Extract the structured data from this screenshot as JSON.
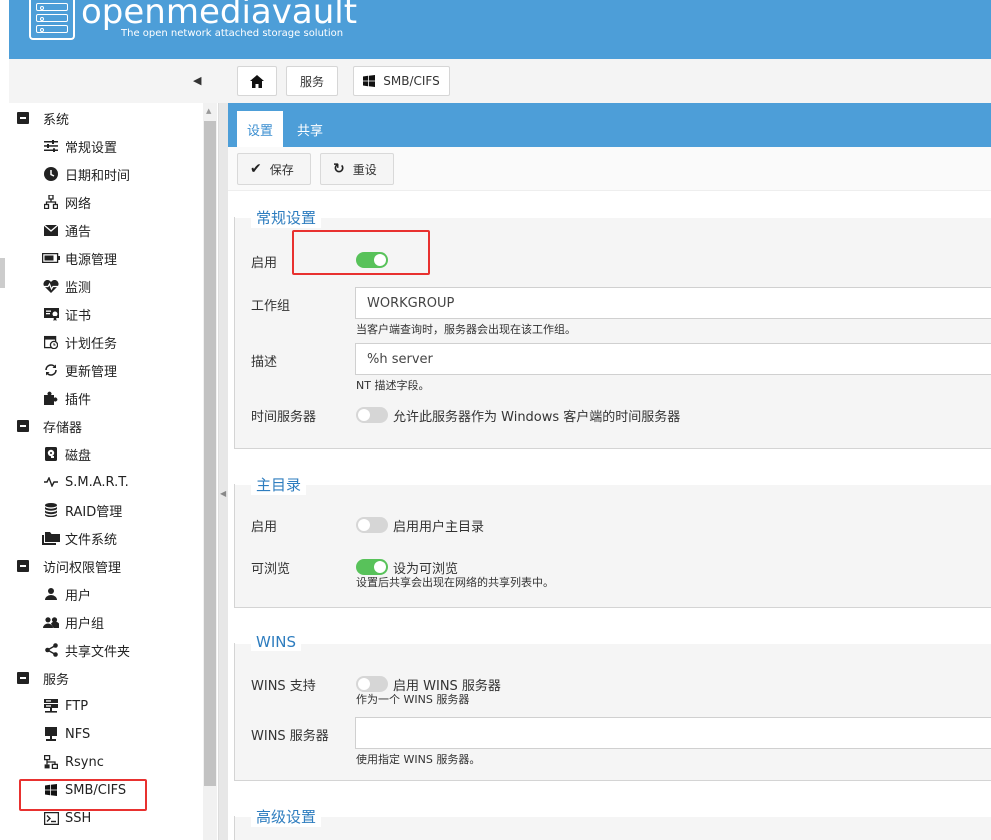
{
  "header": {
    "title": "openmediavault",
    "subtitle": "The open network attached storage solution"
  },
  "breadcrumb": {
    "home_icon": "home-icon",
    "items": [
      "服务",
      "SMB/CIFS"
    ]
  },
  "sidebar": {
    "groups": {
      "system": "系统",
      "storage": "存储器",
      "access": "访问权限管理",
      "services": "服务"
    },
    "items": {
      "general": "常规设置",
      "datetime": "日期和时间",
      "network": "网络",
      "notification": "通告",
      "power": "电源管理",
      "monitoring": "监测",
      "certificates": "证书",
      "scheduled": "计划任务",
      "updates": "更新管理",
      "plugins": "插件",
      "disks": "磁盘",
      "smart": "S.M.A.R.T.",
      "raid": "RAID管理",
      "filesystems": "文件系统",
      "users": "用户",
      "usergroups": "用户组",
      "sharedfolders": "共享文件夹",
      "ftp": "FTP",
      "nfs": "NFS",
      "rsync": "Rsync",
      "smb": "SMB/CIFS",
      "ssh": "SSH"
    }
  },
  "tabs": [
    "设置",
    "共享"
  ],
  "actions": {
    "save": "保存",
    "reset": "重设"
  },
  "general": {
    "legend": "常规设置",
    "enable_label": "启用",
    "enabled": true,
    "workgroup_label": "工作组",
    "workgroup_value": "WORKGROUP",
    "workgroup_hint": "当客户端查询时，服务器会出现在该工作组。",
    "description_label": "描述",
    "description_value": "%h server",
    "description_hint": "NT 描述字段。",
    "timeserver_label": "时间服务器",
    "timeserver_text": "允许此服务器作为 Windows 客户端的时间服务器",
    "timeserver_on": false
  },
  "homes": {
    "legend": "主目录",
    "enable_label": "启用",
    "enable_text": "启用用户主目录",
    "enabled": false,
    "browse_label": "可浏览",
    "browse_text": "设为可浏览",
    "browse_on": true,
    "browse_hint": "设置后共享会出现在网络的共享列表中。"
  },
  "wins": {
    "legend": "WINS",
    "support_label": "WINS 支持",
    "support_text": "启用 WINS 服务器",
    "support_on": false,
    "support_hint": "作为一个 WINS 服务器",
    "server_label": "WINS 服务器",
    "server_value": "",
    "server_hint": "使用指定 WINS 服务器。"
  },
  "advanced": {
    "legend": "高级设置"
  },
  "colors": {
    "brand": "#4d9ed8",
    "toggle_on": "#58c25a",
    "highlight": "#e8312f"
  }
}
